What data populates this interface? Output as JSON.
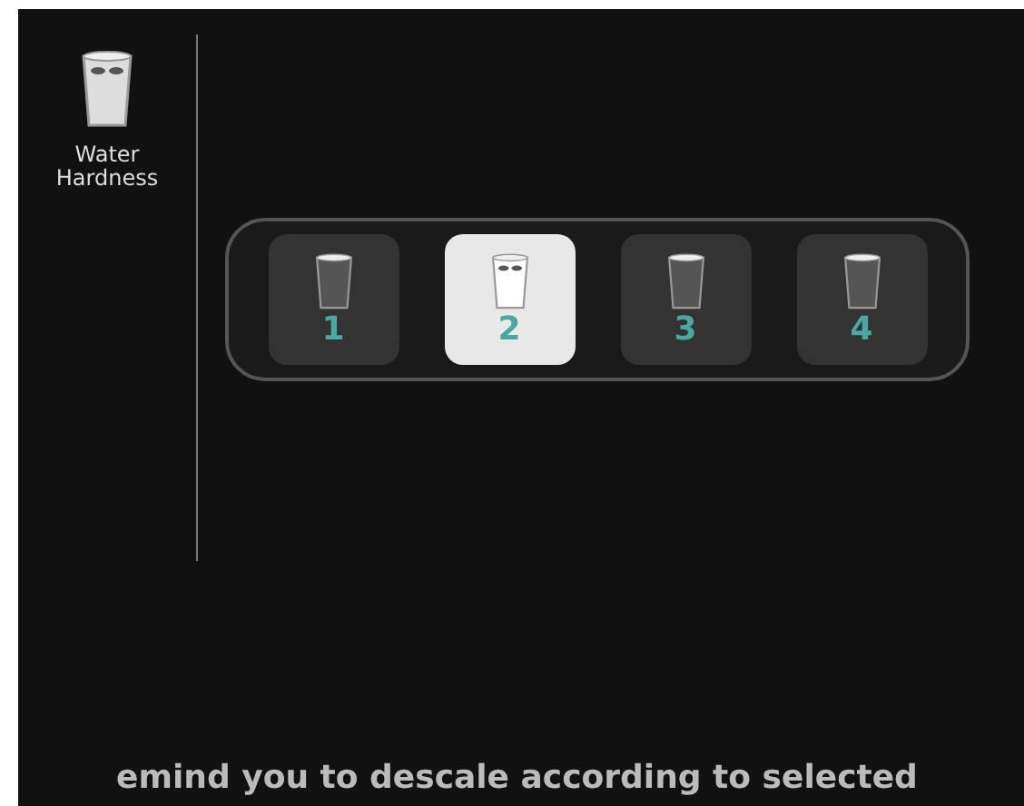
{
  "sidebar": {
    "label": "Water Hardness"
  },
  "levels": [
    {
      "number": "1",
      "selected": false
    },
    {
      "number": "2",
      "selected": true
    },
    {
      "number": "3",
      "selected": false
    },
    {
      "number": "4",
      "selected": false
    }
  ],
  "message": "emind you to descale according to selected"
}
